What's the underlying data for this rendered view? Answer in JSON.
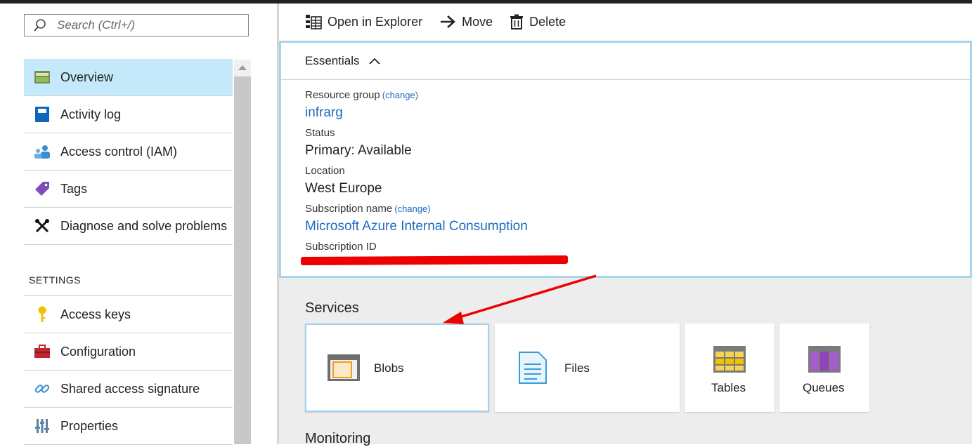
{
  "search": {
    "placeholder": "Search (Ctrl+/)"
  },
  "sidebar": {
    "items": [
      {
        "label": "Overview",
        "icon": "overview-icon"
      },
      {
        "label": "Activity log",
        "icon": "activity-log-icon"
      },
      {
        "label": "Access control (IAM)",
        "icon": "people-icon"
      },
      {
        "label": "Tags",
        "icon": "tag-icon"
      },
      {
        "label": "Diagnose and solve problems",
        "icon": "wrench-icon"
      }
    ],
    "settings_header": "SETTINGS",
    "settings_items": [
      {
        "label": "Access keys",
        "icon": "key-icon"
      },
      {
        "label": "Configuration",
        "icon": "toolbox-icon"
      },
      {
        "label": "Shared access signature",
        "icon": "link-icon"
      },
      {
        "label": "Properties",
        "icon": "properties-icon"
      }
    ]
  },
  "toolbar": {
    "open_explorer": "Open in Explorer",
    "move": "Move",
    "delete": "Delete"
  },
  "essentials": {
    "title": "Essentials",
    "resource_group_label": "Resource group",
    "resource_group_change": "(change)",
    "resource_group_value": "infrarg",
    "status_label": "Status",
    "status_value": "Primary: Available",
    "location_label": "Location",
    "location_value": "West Europe",
    "subscription_name_label": "Subscription name",
    "subscription_name_change": "(change)",
    "subscription_name_value": "Microsoft Azure Internal Consumption",
    "subscription_id_label": "Subscription ID"
  },
  "services": {
    "title": "Services",
    "tiles": [
      {
        "label": "Blobs",
        "icon": "blob-container-icon"
      },
      {
        "label": "Files",
        "icon": "file-icon"
      },
      {
        "label": "Tables",
        "icon": "table-icon"
      },
      {
        "label": "Queues",
        "icon": "queue-icon"
      }
    ]
  },
  "monitoring": {
    "title": "Monitoring"
  },
  "colors": {
    "accent": "#1c6ac1",
    "active_nav": "#c3e9fa",
    "annotation": "#ee0000"
  }
}
